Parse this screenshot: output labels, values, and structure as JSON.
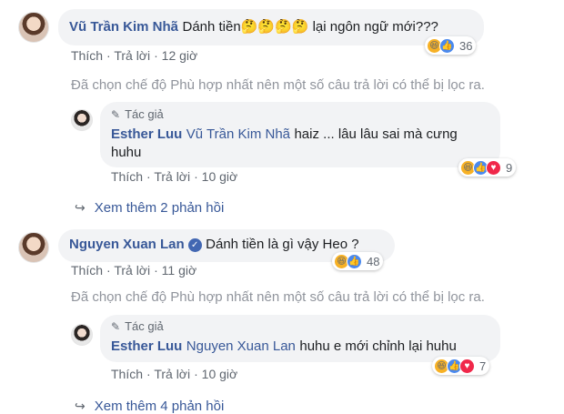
{
  "comments": [
    {
      "author": "Vũ Trần Kim Nhã",
      "text_before": "Dánh tiền",
      "emoji": "🤔🤔🤔🤔",
      "text_after": "lại ngôn ngữ mới???",
      "reactions": {
        "icons": [
          "haha-icon",
          "like-icon"
        ],
        "count": "36"
      },
      "actions": {
        "like": "Thích",
        "reply": "Trả lời",
        "time": "12 giờ"
      },
      "filter_notice": "Đã chọn chế độ Phù hợp nhất nên một số câu trả lời có thể bị lọc ra.",
      "reply": {
        "badge": "Tác giả",
        "author": "Esther Luu",
        "mention": "Vũ Trần Kim Nhã",
        "text_line1": "haiz ... lâu lâu sai mà cưng",
        "text_line2": "huhu",
        "reactions": {
          "icons": [
            "haha-icon",
            "like-icon",
            "love-icon"
          ],
          "count": "9"
        },
        "actions": {
          "like": "Thích",
          "reply": "Trả lời",
          "time": "10 giờ"
        }
      },
      "more_replies": "Xem thêm 2 phản hồi"
    },
    {
      "author": "Nguyen Xuan Lan",
      "verified": true,
      "text": "Dánh tiền là gì vậy Heo ?",
      "reactions": {
        "icons": [
          "haha-icon",
          "like-icon"
        ],
        "count": "48"
      },
      "actions": {
        "like": "Thích",
        "reply": "Trả lời",
        "time": "11 giờ"
      },
      "filter_notice": "Đã chọn chế độ Phù hợp nhất nên một số câu trả lời có thể bị lọc ra.",
      "reply": {
        "badge": "Tác giả",
        "author": "Esther Luu",
        "mention": "Nguyen Xuan Lan",
        "text": "huhu e mới chỉnh lại huhu",
        "reactions": {
          "icons": [
            "haha-icon",
            "like-icon",
            "love-icon"
          ],
          "count": "7"
        },
        "actions": {
          "like": "Thích",
          "reply": "Trả lời",
          "time": "10 giờ"
        }
      },
      "more_replies": "Xem thêm 4 phản hồi"
    }
  ],
  "colors": {
    "name": "#385898",
    "bubble": "#f2f3f5",
    "meta": "#606770",
    "muted": "#90949c"
  }
}
